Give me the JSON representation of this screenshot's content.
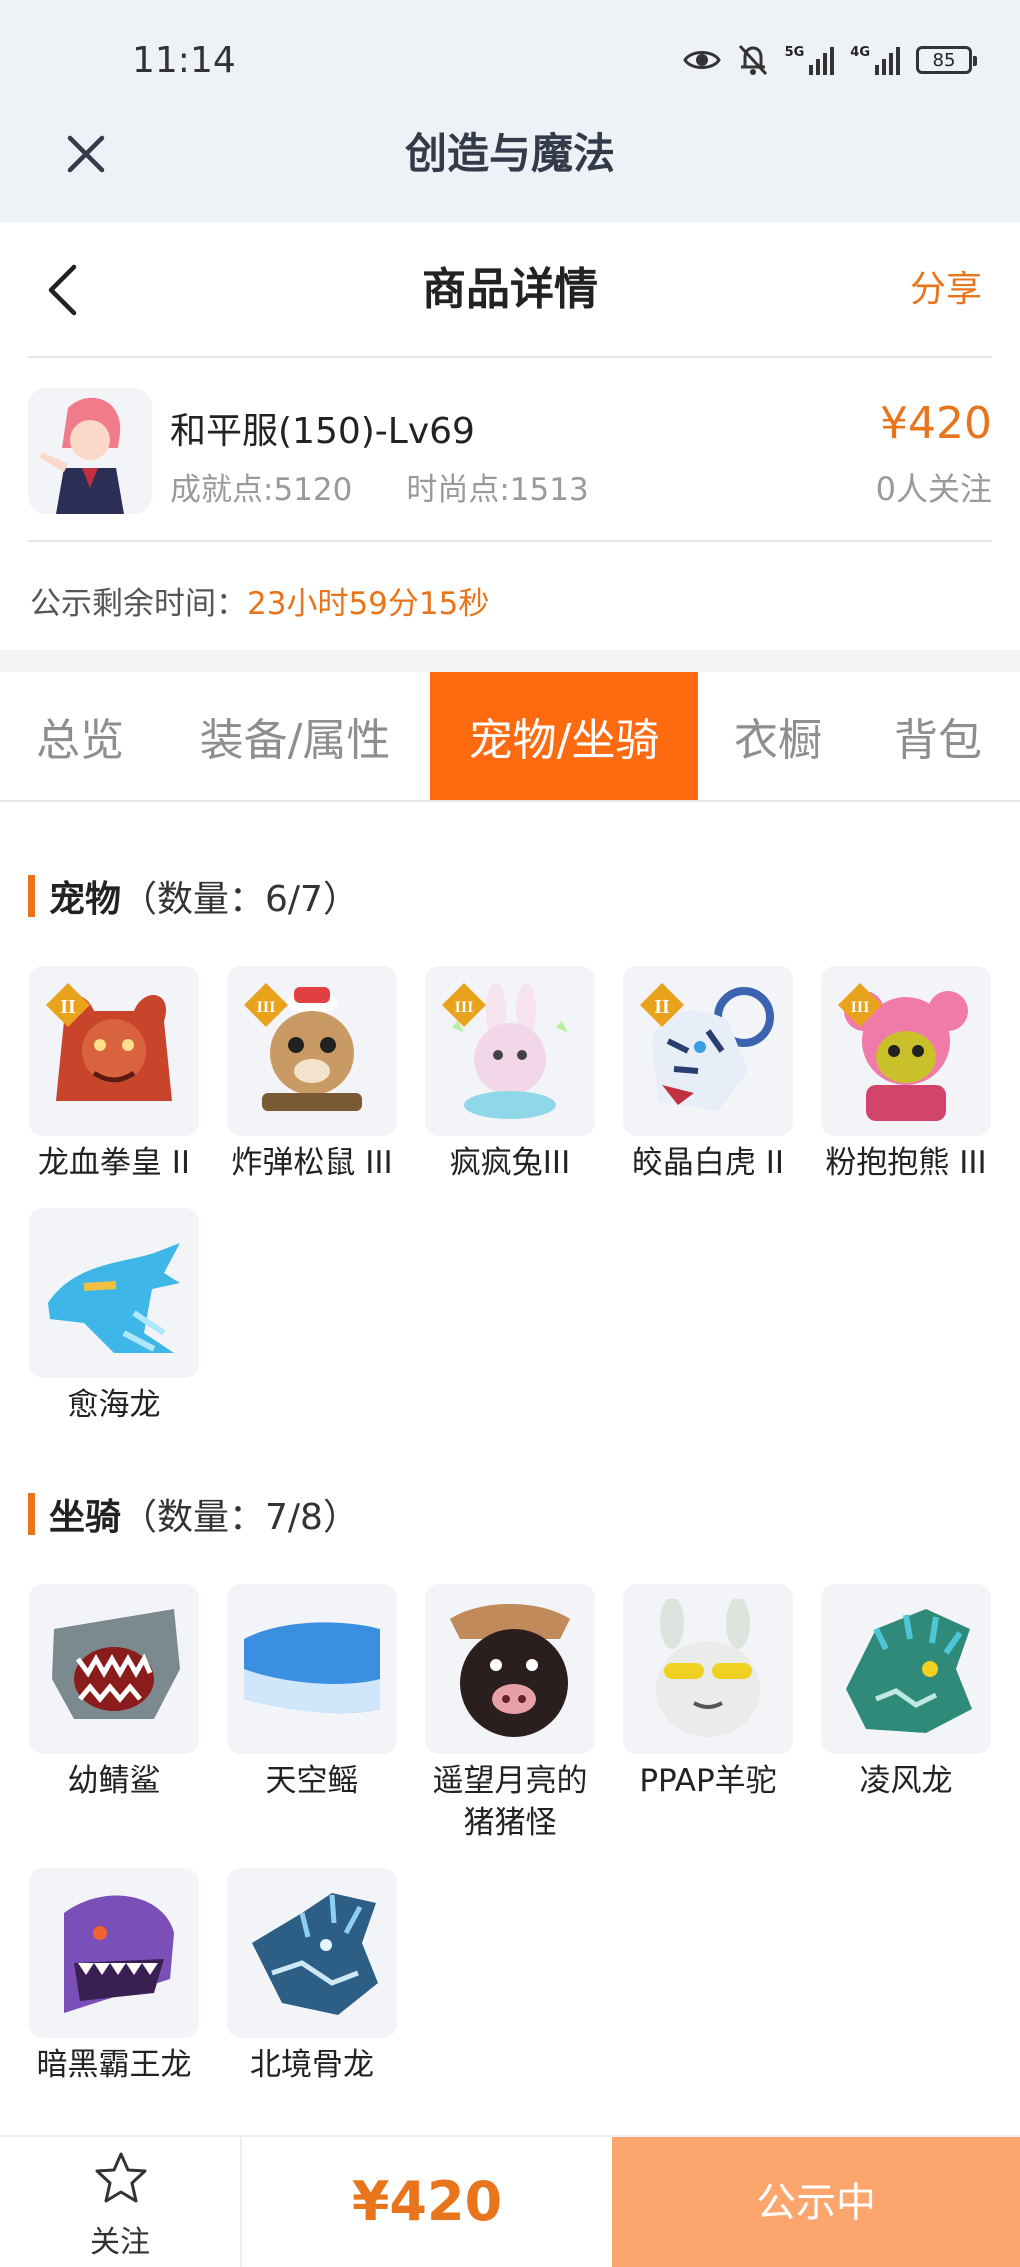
{
  "status_bar": {
    "time": "11:14",
    "network_1": "5G",
    "network_2": "4G",
    "battery": "85"
  },
  "app_header": {
    "title": "创造与魔法",
    "close_icon": "close-icon"
  },
  "nav": {
    "title": "商品详情",
    "share_label": "分享",
    "back_icon": "chevron-left-icon"
  },
  "product": {
    "name": "和平服(150)-Lv69",
    "achievement": "成就点:5120",
    "fashion": "时尚点:1513",
    "price": "¥420",
    "followers": "0人关注"
  },
  "countdown": {
    "label": "公示剩余时间：",
    "value": "23小时59分15秒"
  },
  "tabs": [
    {
      "label": "总览",
      "active": false
    },
    {
      "label": "装备/属性",
      "active": false
    },
    {
      "label": "宠物/坐骑",
      "active": true
    },
    {
      "label": "衣橱",
      "active": false
    },
    {
      "label": "背包",
      "active": false
    }
  ],
  "pets": {
    "title": "宠物",
    "count": "（数量：6/7）",
    "items": [
      {
        "name": "龙血拳皇 II",
        "badge": "II",
        "color": "#c8442a"
      },
      {
        "name": "炸弹松鼠 III",
        "badge": "III",
        "color": "#c99a63"
      },
      {
        "name": "疯疯兔III",
        "badge": "III",
        "color": "#f2d7e8"
      },
      {
        "name": "皎晶白虎 II",
        "badge": "II",
        "color": "#3b63b0"
      },
      {
        "name": "粉抱抱熊 III",
        "badge": "III",
        "color": "#f07aa8"
      },
      {
        "name": "愈海龙",
        "badge": "",
        "color": "#3fb6e8"
      }
    ]
  },
  "mounts": {
    "title": "坐骑",
    "count": "（数量：7/8）",
    "items": [
      {
        "name": "幼鲭鲨",
        "color": "#7b8a8f"
      },
      {
        "name": "天空鳐",
        "color": "#3a8fe0"
      },
      {
        "name": "遥望月亮的猪猪怪",
        "color": "#2b1e1e"
      },
      {
        "name": "PPAP羊驼",
        "color": "#e9ece8"
      },
      {
        "name": "凌风龙",
        "color": "#2f8a7a"
      },
      {
        "name": "暗黑霸王龙",
        "color": "#7a4fb8"
      },
      {
        "name": "北境骨龙",
        "color": "#2c5e86"
      }
    ]
  },
  "bottom_bar": {
    "follow_label": "关注",
    "price": "¥420",
    "status_label": "公示中"
  }
}
